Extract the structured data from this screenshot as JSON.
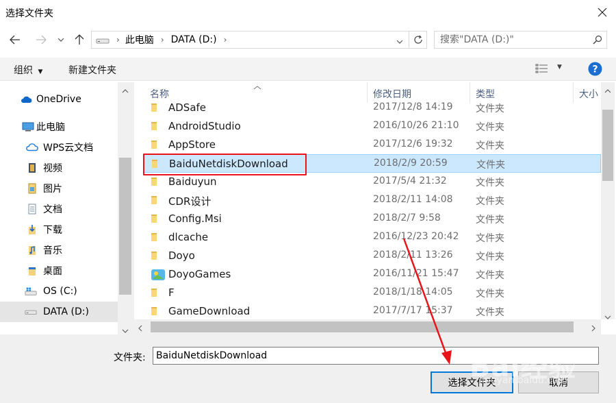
{
  "window": {
    "title": "选择文件夹"
  },
  "nav": {
    "breadcrumb": [
      "此电脑",
      "DATA (D:)"
    ],
    "search_placeholder": "搜索\"DATA (D:)\""
  },
  "toolbar": {
    "organize_label": "组织",
    "new_folder_label": "新建文件夹"
  },
  "sidebar": {
    "items": [
      {
        "label": "OneDrive",
        "icon": "cloud-icon"
      },
      {
        "label": "此电脑",
        "icon": "computer-icon"
      },
      {
        "label": "WPS云文档",
        "icon": "wps-cloud-icon"
      },
      {
        "label": "视频",
        "icon": "video-icon"
      },
      {
        "label": "图片",
        "icon": "pictures-icon"
      },
      {
        "label": "文档",
        "icon": "documents-icon"
      },
      {
        "label": "下载",
        "icon": "download-icon"
      },
      {
        "label": "音乐",
        "icon": "music-icon"
      },
      {
        "label": "桌面",
        "icon": "desktop-icon"
      },
      {
        "label": "OS (C:)",
        "icon": "drive-icon"
      },
      {
        "label": "DATA (D:)",
        "icon": "drive-icon"
      }
    ]
  },
  "list": {
    "columns": [
      "名称",
      "修改日期",
      "类型",
      "大小"
    ],
    "rows": [
      {
        "name": "ADSafe",
        "date": "2017/12/8 14:19",
        "type": "文件夹"
      },
      {
        "name": "AndroidStudio",
        "date": "2016/10/26 21:10",
        "type": "文件夹"
      },
      {
        "name": "AppStore",
        "date": "2017/12/6 19:32",
        "type": "文件夹"
      },
      {
        "name": "BaiduNetdiskDownload",
        "date": "2018/2/9 20:59",
        "type": "文件夹"
      },
      {
        "name": "Baiduyun",
        "date": "2017/5/4 21:32",
        "type": "文件夹"
      },
      {
        "name": "CDR设计",
        "date": "2018/2/11 14:08",
        "type": "文件夹"
      },
      {
        "name": "Config.Msi",
        "date": "2018/2/7 9:58",
        "type": "文件夹"
      },
      {
        "name": "dlcache",
        "date": "2016/12/23 20:42",
        "type": "文件夹"
      },
      {
        "name": "Doyo",
        "date": "2018/2/11 13:26",
        "type": "文件夹"
      },
      {
        "name": "DoyoGames",
        "date": "2016/11/21 15:47",
        "type": "文件夹"
      },
      {
        "name": "F",
        "date": "2018/1/18 14:05",
        "type": "文件夹"
      },
      {
        "name": "GameDownload",
        "date": "2017/7/17 15:37",
        "type": "文件夹"
      }
    ],
    "selected_index": 3
  },
  "footer": {
    "folder_label": "文件夹:",
    "folder_value": "BaiduNetdiskDownload",
    "select_button": "选择文件夹",
    "cancel_button": "取消"
  },
  "watermark": {
    "text": "Bai经验",
    "sub": "jingyan.baidu.com"
  },
  "colors": {
    "accent": "#0078d7",
    "selection": "#cce8ff",
    "annotation": "#e8141a",
    "folder": "#f8d775"
  }
}
